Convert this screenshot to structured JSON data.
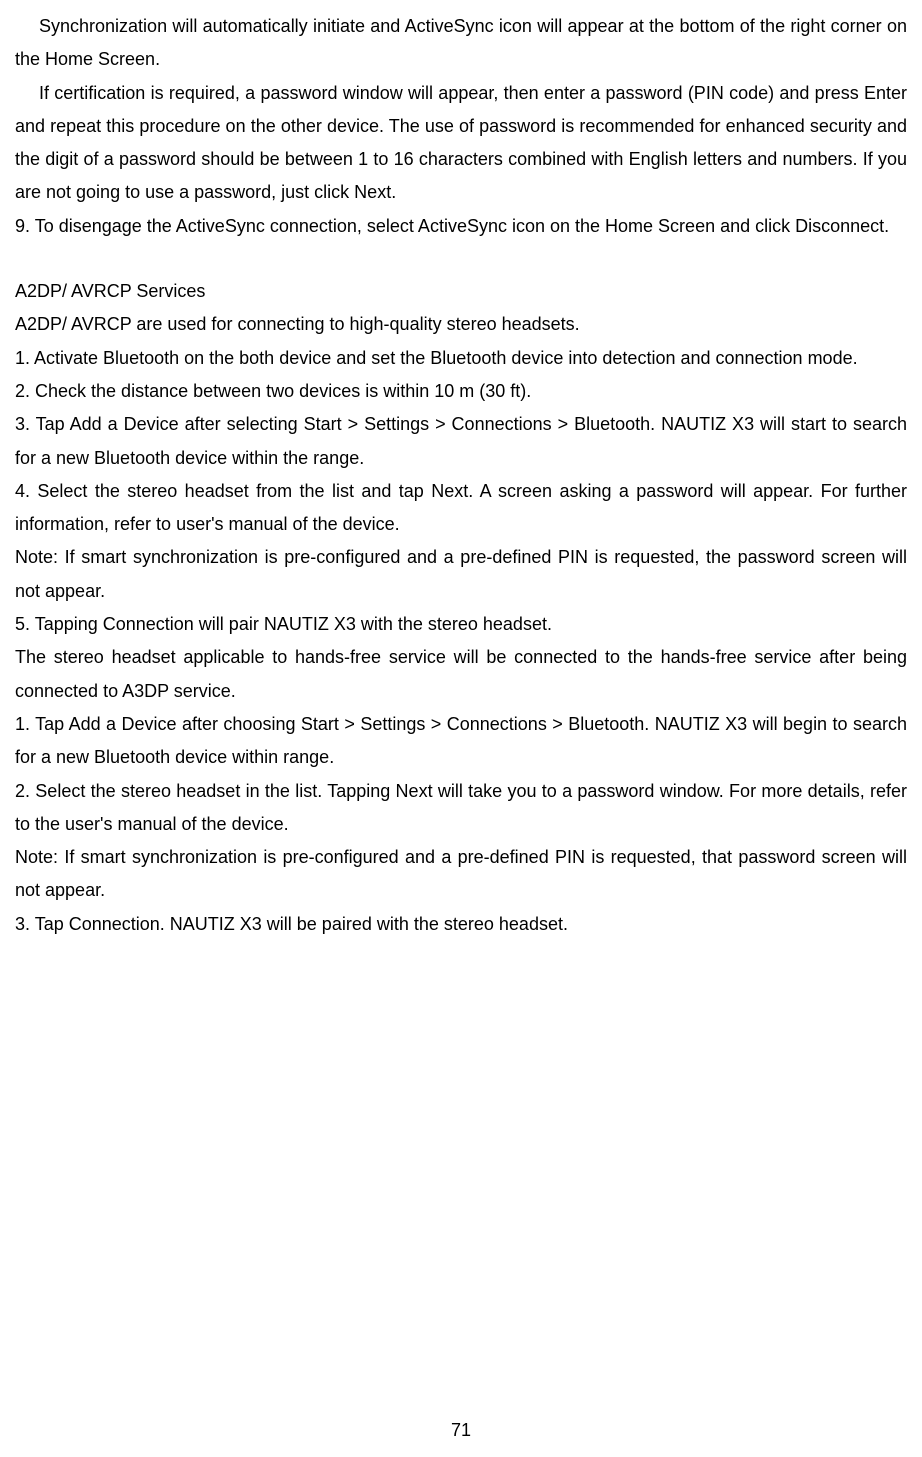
{
  "p1": "Synchronization will automatically initiate and ActiveSync icon will appear at the bottom of the right corner on the Home Screen.",
  "p2": "If certification is required, a password window will appear, then enter a password (PIN code) and press Enter and repeat this procedure on the other device. The use of password is recommended for enhanced security and the digit of a password should be between 1 to 16 characters combined with English letters and numbers. If you are not going to use a password, just click Next.",
  "p3": "9. To disengage the ActiveSync connection, select ActiveSync icon on the Home Screen and click Disconnect.",
  "heading": "A2DP/ AVRCP Services",
  "p4": "A2DP/ AVRCP are used for connecting to high-quality stereo headsets.",
  "p5": "1. Activate Bluetooth on the both device and set the Bluetooth device into detection and connection mode.",
  "p6": "2. Check the distance between two devices is within 10 m (30 ft).",
  "p7": "3. Tap Add a Device after selecting Start > Settings > Connections > Bluetooth. NAUTIZ X3 will start to search for a new Bluetooth device within the range.",
  "p8": "4. Select the stereo headset from the list and tap Next. A screen asking a password will appear. For further information, refer to user's manual of the device.",
  "p9": "Note: If smart synchronization is pre-configured and a pre-defined PIN is requested, the password screen will not appear.",
  "p10": "5. Tapping Connection will pair NAUTIZ X3 with the stereo headset.",
  "p11": "The stereo headset applicable to hands-free service will be connected to the hands-free service after being connected to A3DP service.",
  "p12": "1. Tap Add a Device after choosing Start > Settings > Connections > Bluetooth. NAUTIZ X3 will begin to search for a new Bluetooth device within range.",
  "p13": "2. Select the stereo headset in the list. Tapping Next will take you to a password window. For more details, refer to the user's manual of the device.",
  "p14": "Note: If smart synchronization is pre-configured and a pre-defined PIN is requested, that password screen will not appear.",
  "p15": "3. Tap Connection. NAUTIZ X3 will be paired with the stereo headset.",
  "page_number": "71"
}
